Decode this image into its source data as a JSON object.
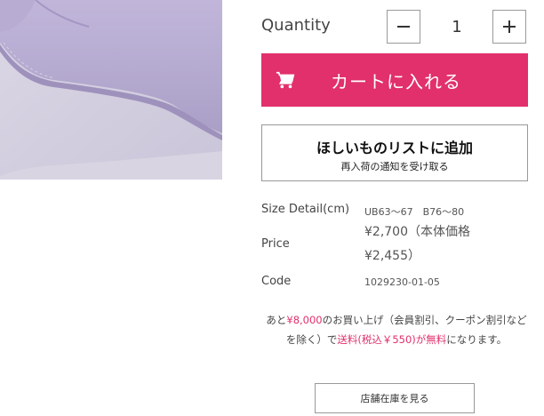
{
  "quantity": {
    "label": "Quantity",
    "value": "1",
    "minus_icon": "minus-icon",
    "plus_icon": "plus-icon"
  },
  "cart_button": {
    "label": "カートに入れる",
    "icon": "shopping-cart-icon",
    "color": "#e1306c"
  },
  "wishlist_button": {
    "title": "ほしいものリストに追加",
    "subtitle": "再入荷の通知を受け取る"
  },
  "details": {
    "size_label": "Size Detail(cm)",
    "size_value": "UB63〜67　B76〜80",
    "price_label": "Price",
    "price_line1": "¥2,700（本体価格",
    "price_line2": "¥2,455）",
    "code_label": "Code",
    "code_value": "1029230-01-05"
  },
  "shipping_notice": {
    "prefix": "あと",
    "amount": "¥8,000",
    "middle": "のお買い上げ（会員割引、クーポン割引などを除く）で",
    "highlight": "送料(税込￥550)が無料",
    "suffix": "になります。",
    "highlight_color": "#e1306c"
  },
  "store_stock_button": {
    "label": "店舗在庫を見る"
  }
}
